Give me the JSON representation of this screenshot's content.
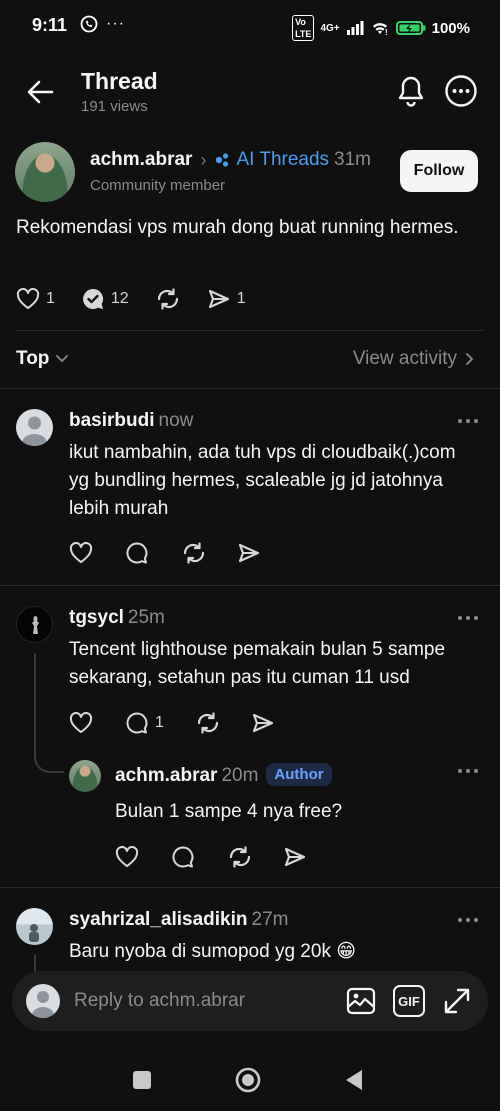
{
  "status_bar": {
    "time": "9:11",
    "network": "4G+",
    "battery": "100%"
  },
  "header": {
    "title": "Thread",
    "views": "191 views"
  },
  "post": {
    "author": "achm.abrar",
    "topic": "AI Threads",
    "time_ago": "31m",
    "role": "Community member",
    "follow_label": "Follow",
    "text": "Rekomendasi vps murah dong buat running hermes.",
    "likes": "1",
    "replies": "12",
    "shares": "1"
  },
  "sort": {
    "label": "Top",
    "view_activity": "View activity"
  },
  "replies": [
    {
      "author": "basirbudi",
      "time_ago": "now",
      "text": "ikut nambahin, ada tuh vps di cloudbaik(.)com yg bundling hermes, scaleable jg jd jatohnya lebih murah"
    },
    {
      "author": "tgsycl",
      "time_ago": "25m",
      "text": "Tencent lighthouse pemakain bulan 5 sampe sekarang, setahun pas itu cuman 11 usd",
      "reply_count": "1"
    },
    {
      "author": "achm.abrar",
      "time_ago": "20m",
      "badge": "Author",
      "text": "Bulan 1 sampe 4 nya free?"
    },
    {
      "author": "syahrizal_alisadikin",
      "time_ago": "27m",
      "text": "Baru nyoba di sumopod yg 20k 😁"
    }
  ],
  "composer": {
    "placeholder": "Reply to achm.abrar",
    "gif_label": "GIF"
  },
  "colors": {
    "background": "#101010",
    "accent_blue": "#4c9bf0",
    "muted": "#8b8b8b"
  },
  "icons": [
    "back-arrow-icon",
    "bell-icon",
    "more-icon",
    "heart-icon",
    "comment-icon",
    "repost-icon",
    "share-icon",
    "image-icon",
    "expand-icon"
  ]
}
